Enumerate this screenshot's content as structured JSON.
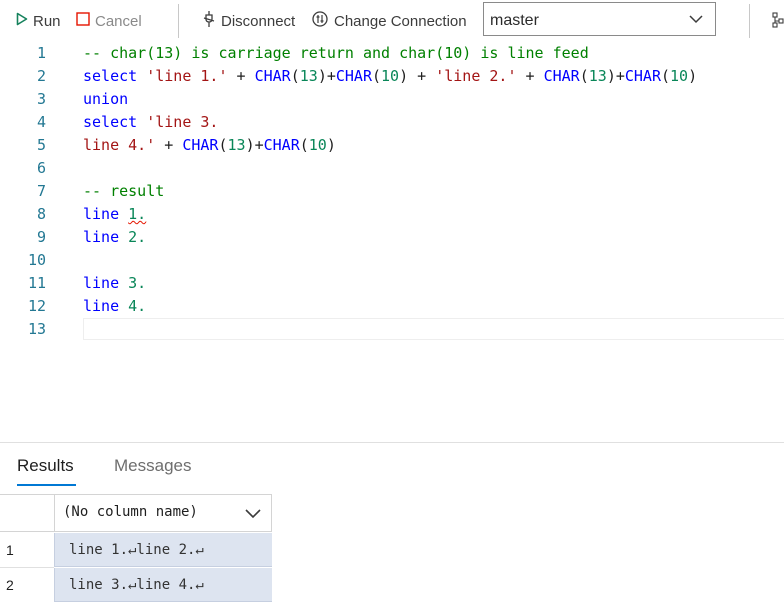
{
  "toolbar": {
    "run_label": "Run",
    "cancel_label": "Cancel",
    "disconnect_label": "Disconnect",
    "change_connection_label": "Change Connection",
    "database": "master",
    "icons": {
      "run": "play-icon",
      "cancel": "stop-icon",
      "disconnect": "disconnect-icon",
      "change": "change-connection-icon",
      "chevron": "chevron-down-icon",
      "extra": "query-plan-icon"
    }
  },
  "editor": {
    "line_numbers": [
      "1",
      "2",
      "3",
      "4",
      "5",
      "6",
      "7",
      "8",
      "9",
      "10",
      "11",
      "12",
      "13"
    ],
    "lines": [
      [
        {
          "t": "-- char(13) is carriage return and char(10) is line feed",
          "c": "cm"
        }
      ],
      [
        {
          "t": "select ",
          "c": "kw"
        },
        {
          "t": "'line 1.'",
          "c": "str"
        },
        {
          "t": " + ",
          "c": "op"
        },
        {
          "t": "CHAR",
          "c": "fn"
        },
        {
          "t": "(",
          "c": "op"
        },
        {
          "t": "13",
          "c": "num"
        },
        {
          "t": ")+",
          "c": "op"
        },
        {
          "t": "CHAR",
          "c": "fn"
        },
        {
          "t": "(",
          "c": "op"
        },
        {
          "t": "10",
          "c": "num"
        },
        {
          "t": ") + ",
          "c": "op"
        },
        {
          "t": "'line 2.'",
          "c": "str"
        },
        {
          "t": " + ",
          "c": "op"
        },
        {
          "t": "CHAR",
          "c": "fn"
        },
        {
          "t": "(",
          "c": "op"
        },
        {
          "t": "13",
          "c": "num"
        },
        {
          "t": ")+",
          "c": "op"
        },
        {
          "t": "CHAR",
          "c": "fn"
        },
        {
          "t": "(",
          "c": "op"
        },
        {
          "t": "10",
          "c": "num"
        },
        {
          "t": ")",
          "c": "op"
        }
      ],
      [
        {
          "t": "union",
          "c": "kw"
        }
      ],
      [
        {
          "t": "select ",
          "c": "kw"
        },
        {
          "t": "'line 3.",
          "c": "str"
        }
      ],
      [
        {
          "t": "line 4.'",
          "c": "str"
        },
        {
          "t": " + ",
          "c": "op"
        },
        {
          "t": "CHAR",
          "c": "fn"
        },
        {
          "t": "(",
          "c": "op"
        },
        {
          "t": "13",
          "c": "num"
        },
        {
          "t": ")+",
          "c": "op"
        },
        {
          "t": "CHAR",
          "c": "fn"
        },
        {
          "t": "(",
          "c": "op"
        },
        {
          "t": "10",
          "c": "num"
        },
        {
          "t": ")",
          "c": "op"
        }
      ],
      [],
      [
        {
          "t": "-- result",
          "c": "cm"
        }
      ],
      [
        {
          "t": "line ",
          "c": "kw"
        },
        {
          "t": "1.",
          "c": "num squig"
        }
      ],
      [
        {
          "t": "line ",
          "c": "kw"
        },
        {
          "t": "2.",
          "c": "num"
        }
      ],
      [],
      [
        {
          "t": "line ",
          "c": "kw"
        },
        {
          "t": "3.",
          "c": "num"
        }
      ],
      [
        {
          "t": "line ",
          "c": "kw"
        },
        {
          "t": "4.",
          "c": "num"
        }
      ],
      []
    ]
  },
  "results": {
    "tabs": [
      "Results",
      "Messages"
    ],
    "column_header": "(No column name)",
    "rows": [
      {
        "num": "1",
        "value": "line 1.↵line 2.↵"
      },
      {
        "num": "2",
        "value": "line 3.↵line 4.↵"
      }
    ]
  },
  "colors": {
    "accent": "#0078d4",
    "run_green": "#16825d",
    "cancel_red": "#e51400",
    "selection": "#dde4f0"
  }
}
